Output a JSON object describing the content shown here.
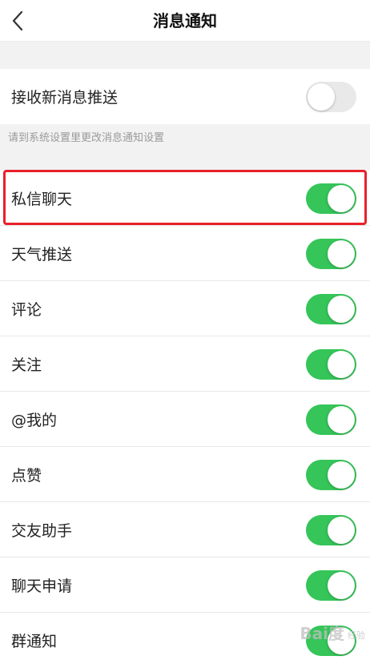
{
  "header": {
    "title": "消息通知"
  },
  "push": {
    "label": "接收新消息推送",
    "enabled": false,
    "hint": "请到系统设置里更改消息通知设置"
  },
  "notifications": [
    {
      "label": "私信聊天",
      "enabled": true
    },
    {
      "label": "天气推送",
      "enabled": true
    },
    {
      "label": "评论",
      "enabled": true
    },
    {
      "label": "关注",
      "enabled": true
    },
    {
      "label": "@我的",
      "enabled": true
    },
    {
      "label": "点赞",
      "enabled": true
    },
    {
      "label": "交友助手",
      "enabled": true
    },
    {
      "label": "聊天申请",
      "enabled": true
    },
    {
      "label": "群通知",
      "enabled": true
    }
  ],
  "colors": {
    "toggle_on": "#35c559",
    "toggle_off": "#e9e9ea",
    "highlight": "#e8202a"
  },
  "icons": {
    "back": "chevron-left-icon"
  },
  "watermark": {
    "main": "Bai度",
    "sub": "经验"
  }
}
